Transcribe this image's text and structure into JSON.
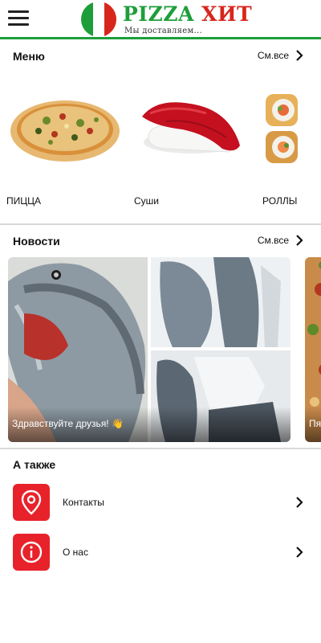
{
  "header": {
    "brand_pizza": "PIZZA",
    "brand_hit": "ХИТ",
    "tagline": "Мы доставляем...",
    "colors": {
      "green": "#1e9e3a",
      "red": "#d7261c",
      "white": "#ffffff"
    }
  },
  "menu": {
    "title": "Меню",
    "see_all": "См.все",
    "items": [
      {
        "label": "ПИЦЦА",
        "icon": "pizza-image"
      },
      {
        "label": "Суши",
        "icon": "sushi-image"
      },
      {
        "label": "РОЛЛЫ",
        "icon": "rolls-image"
      }
    ]
  },
  "news": {
    "title": "Новости",
    "see_all": "См.все",
    "cards": [
      {
        "caption": "Здравствуйте друзья! 👋",
        "image": "salmon-photo-collage"
      },
      {
        "caption": "Пя",
        "image": "pizza-photo"
      }
    ]
  },
  "also": {
    "title": "А также",
    "items": [
      {
        "label": "Контакты",
        "icon": "location-pin-icon"
      },
      {
        "label": "О нас",
        "icon": "info-icon"
      }
    ],
    "accent": "#e8222a"
  }
}
